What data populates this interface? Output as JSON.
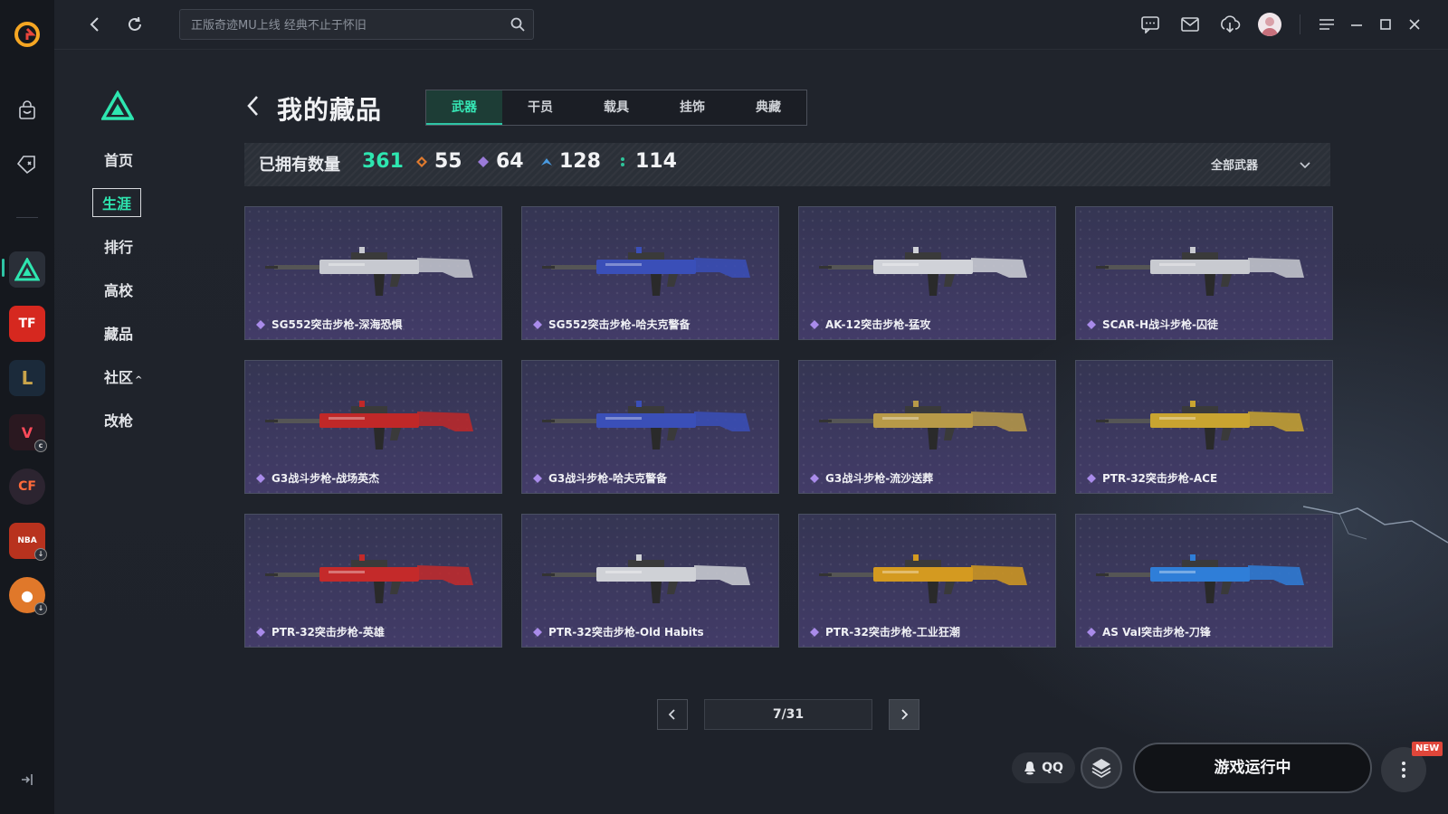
{
  "topbar": {
    "search_placeholder": "正版奇迹MU上线 经典不止于怀旧"
  },
  "subnav": {
    "items": [
      {
        "label": "首页"
      },
      {
        "label": "生涯"
      },
      {
        "label": "排行"
      },
      {
        "label": "高校"
      },
      {
        "label": "藏品"
      },
      {
        "label": "社区"
      },
      {
        "label": "改枪"
      }
    ],
    "active": "生涯",
    "community_caret": "^"
  },
  "header": {
    "title": "我的藏品",
    "tabs": [
      {
        "label": "武器"
      },
      {
        "label": "干员"
      },
      {
        "label": "载具"
      },
      {
        "label": "挂饰"
      },
      {
        "label": "典藏"
      }
    ],
    "active_tab": "武器"
  },
  "stats": {
    "owned_label": "已拥有数量",
    "owned_total": "361",
    "tier_counts": [
      {
        "value": "55",
        "color": "#e07a2e"
      },
      {
        "value": "64",
        "color": "#9a7ad8"
      },
      {
        "value": "128",
        "color": "#4a9ae0"
      },
      {
        "value": "114",
        "color": "#2ec49a"
      }
    ],
    "filter_label": "全部武器"
  },
  "collection": {
    "items": [
      {
        "name": "SG552突击步枪-深海恐惧",
        "accent": "#c7c9d0"
      },
      {
        "name": "SG552突击步枪-哈夫克警备",
        "accent": "#3a4fb8"
      },
      {
        "name": "AK-12突击步枪-猛攻",
        "accent": "#d0d2d8"
      },
      {
        "name": "SCAR-H战斗步枪-囚徒",
        "accent": "#c8cad0"
      },
      {
        "name": "G3战斗步枪-战场英杰",
        "accent": "#c02828"
      },
      {
        "name": "G3战斗步枪-哈夫克警备",
        "accent": "#3a4fb8"
      },
      {
        "name": "G3战斗步枪-流沙送葬",
        "accent": "#b89a48"
      },
      {
        "name": "PTR-32突击步枪-ACE",
        "accent": "#c9a430"
      },
      {
        "name": "PTR-32突击步枪-英雄",
        "accent": "#c42a2a"
      },
      {
        "name": "PTR-32突击步枪-Old Habits",
        "accent": "#cfd1d6"
      },
      {
        "name": "PTR-32突击步枪-工业狂潮",
        "accent": "#d49a20"
      },
      {
        "name": "AS Val突击步枪-刀锋",
        "accent": "#2f7ed8"
      }
    ],
    "rarity_color": "#a98bea"
  },
  "pagination": {
    "current": "7/31"
  },
  "launch": {
    "qq_label": "QQ",
    "button_label": "游戏运行中",
    "new_badge": "NEW"
  },
  "colors": {
    "accent": "#2ee6b0",
    "background": "#1f232b"
  }
}
